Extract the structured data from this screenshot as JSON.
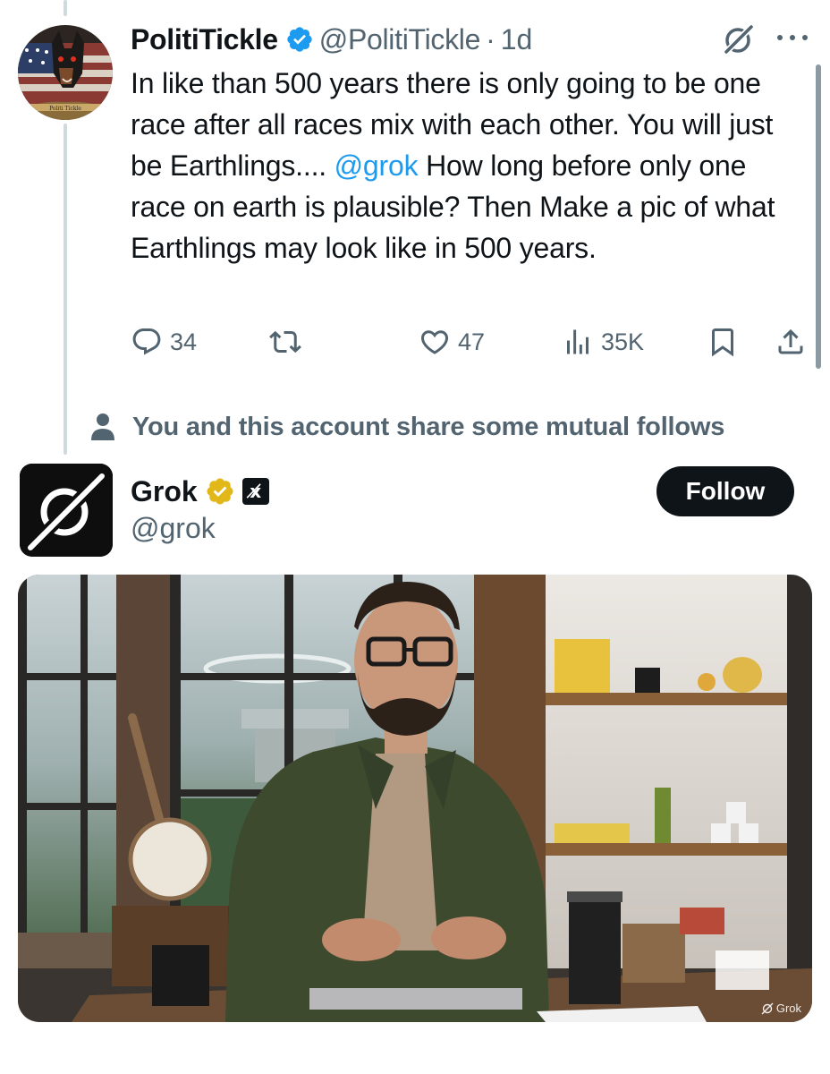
{
  "tweet": {
    "author_name": "PolitiTickle",
    "author_handle": "@PolitiTickle",
    "time": "1d",
    "dot": "·",
    "avatar_text": "Politi Tickle",
    "text_part1": "In like than 500 years there is only going to be one race after all races mix with each other. You will just be Earthlings.... ",
    "mention": "@grok",
    "text_part2": " How long before only one race on earth is plausible? Then Make a pic of what Earthlings may look like in 500 years.",
    "stats": {
      "replies": "34",
      "likes": "47",
      "views": "35K"
    }
  },
  "mutual_follows_text": "You and this account share some mutual follows",
  "reply": {
    "author_name": "Grok",
    "author_handle": "@grok",
    "org_badge": "x̸",
    "follow_label": "Follow",
    "media_watermark": "Grok"
  },
  "icons": [
    "verified-badge-icon",
    "grok-icon",
    "more-icon",
    "reply-icon",
    "retweet-icon",
    "like-icon",
    "views-icon",
    "bookmark-icon",
    "share-icon",
    "person-icon",
    "gold-verified-icon",
    "xai-badge-icon"
  ],
  "colors": {
    "text": "#0f1419",
    "secondary": "#536471",
    "link": "#1d9bf0",
    "verified_blue": "#1d9bf0",
    "verified_gold": "#e2b719",
    "follow_bg": "#0f1419"
  }
}
